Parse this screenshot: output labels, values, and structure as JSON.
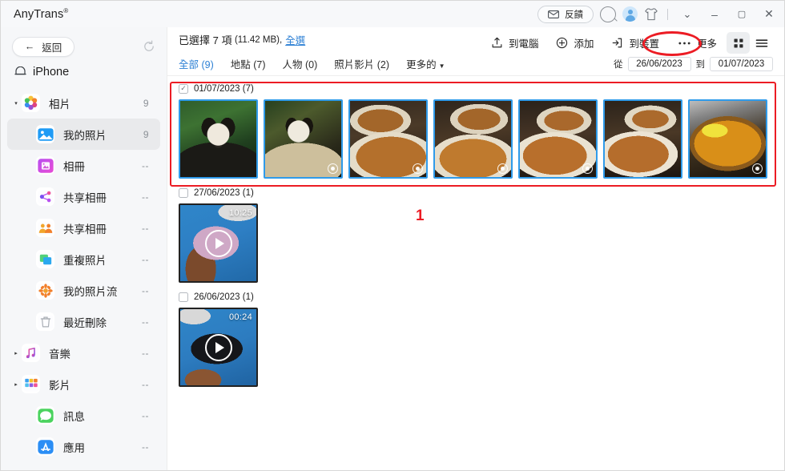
{
  "titlebar": {
    "brand": "AnyTrans",
    "brand_reg": "®",
    "feedback_label": "反饋",
    "icons": {
      "envelope": "envelope-icon",
      "search": "search-icon",
      "avatar": "avatar-icon",
      "shirt": "theme-shirt-icon"
    },
    "window_controls": {
      "more": "⌄",
      "minimize": "–",
      "maximize": "▢",
      "close": "✕"
    }
  },
  "sidebar": {
    "back_label": "返回",
    "back_arrow": "←",
    "refresh_icon": "refresh-icon",
    "device_name": "iPhone",
    "items": [
      {
        "label": "相片",
        "count": "9",
        "icon": "photos-icon",
        "caret": "▾",
        "indent": false,
        "selected": false
      },
      {
        "label": "我的照片",
        "count": "9",
        "icon": "my-photos-icon",
        "caret": "",
        "indent": true,
        "selected": true
      },
      {
        "label": "相冊",
        "count": "--",
        "icon": "albums-icon",
        "caret": "",
        "indent": true,
        "selected": false
      },
      {
        "label": "共享相冊",
        "count": "--",
        "icon": "shared-album-icon",
        "caret": "",
        "indent": true,
        "selected": false
      },
      {
        "label": "共享相冊",
        "count": "--",
        "icon": "shared-people-icon",
        "caret": "",
        "indent": true,
        "selected": false
      },
      {
        "label": "重複照片",
        "count": "--",
        "icon": "duplicate-icon",
        "caret": "",
        "indent": true,
        "selected": false
      },
      {
        "label": "我的照片流",
        "count": "--",
        "icon": "photo-stream-icon",
        "caret": "",
        "indent": true,
        "selected": false
      },
      {
        "label": "最近刪除",
        "count": "--",
        "icon": "trash-icon",
        "caret": "",
        "indent": true,
        "selected": false
      },
      {
        "label": "音樂",
        "count": "--",
        "icon": "music-icon",
        "caret": "▸",
        "indent": false,
        "selected": false
      },
      {
        "label": "影片",
        "count": "--",
        "icon": "video-icon",
        "caret": "▸",
        "indent": false,
        "selected": false
      },
      {
        "label": "訊息",
        "count": "--",
        "icon": "messages-icon",
        "caret": "",
        "indent": true,
        "selected": false
      },
      {
        "label": "應用",
        "count": "--",
        "icon": "appstore-icon",
        "caret": "",
        "indent": true,
        "selected": false
      }
    ]
  },
  "main": {
    "selection": {
      "text": "已選擇 7 項",
      "size": "(11.42 MB),",
      "select_all": "全選"
    },
    "toolbar": [
      {
        "label": "到電腦",
        "icon": "to-computer-icon"
      },
      {
        "label": "添加",
        "icon": "add-plus-icon"
      },
      {
        "label": "到裝置",
        "icon": "to-device-icon"
      },
      {
        "label": "更多",
        "icon": "more-dots-icon"
      }
    ],
    "view_modes": [
      {
        "name": "grid-view",
        "active": true
      },
      {
        "name": "list-view",
        "active": false
      }
    ],
    "tabs": [
      {
        "label": "全部 (9)",
        "active": true,
        "dropdown": false
      },
      {
        "label": "地點 (7)",
        "active": false,
        "dropdown": false
      },
      {
        "label": "人物 (0)",
        "active": false,
        "dropdown": false
      },
      {
        "label": "照片影片 (2)",
        "active": false,
        "dropdown": false
      },
      {
        "label": "更多的",
        "active": false,
        "dropdown": true
      }
    ],
    "date_range": {
      "from_label": "從",
      "from_value": "26/06/2023",
      "to_label": "到",
      "to_value": "01/07/2023"
    },
    "groups": [
      {
        "date": "01/07/2023 (7)",
        "checked": true,
        "check_glyph": "✓",
        "items": [
          {
            "kind": "photo",
            "subject": "panda-1",
            "selected": true,
            "live": false,
            "duration": ""
          },
          {
            "kind": "photo",
            "subject": "panda-2",
            "selected": true,
            "live": true,
            "duration": ""
          },
          {
            "kind": "photo",
            "subject": "pasta-1",
            "selected": true,
            "live": true,
            "duration": ""
          },
          {
            "kind": "photo",
            "subject": "pasta-2",
            "selected": true,
            "live": true,
            "duration": ""
          },
          {
            "kind": "photo",
            "subject": "pasta-3",
            "selected": true,
            "live": true,
            "duration": ""
          },
          {
            "kind": "photo",
            "subject": "pasta-4",
            "selected": true,
            "live": false,
            "duration": ""
          },
          {
            "kind": "photo",
            "subject": "pan-food",
            "selected": true,
            "live": true,
            "duration": ""
          }
        ]
      },
      {
        "date": "27/06/2023 (1)",
        "checked": false,
        "check_glyph": "",
        "items": [
          {
            "kind": "video",
            "subject": "phone-charging",
            "selected": false,
            "live": false,
            "duration": "10:25"
          }
        ]
      },
      {
        "date": "26/06/2023 (1)",
        "checked": false,
        "check_glyph": "",
        "items": [
          {
            "kind": "video",
            "subject": "phone-desk",
            "selected": false,
            "live": false,
            "duration": "00:24"
          }
        ]
      }
    ]
  },
  "annotations": {
    "step_number": "1",
    "accent_color": "#ec1c24",
    "highlight_target": "更多"
  }
}
